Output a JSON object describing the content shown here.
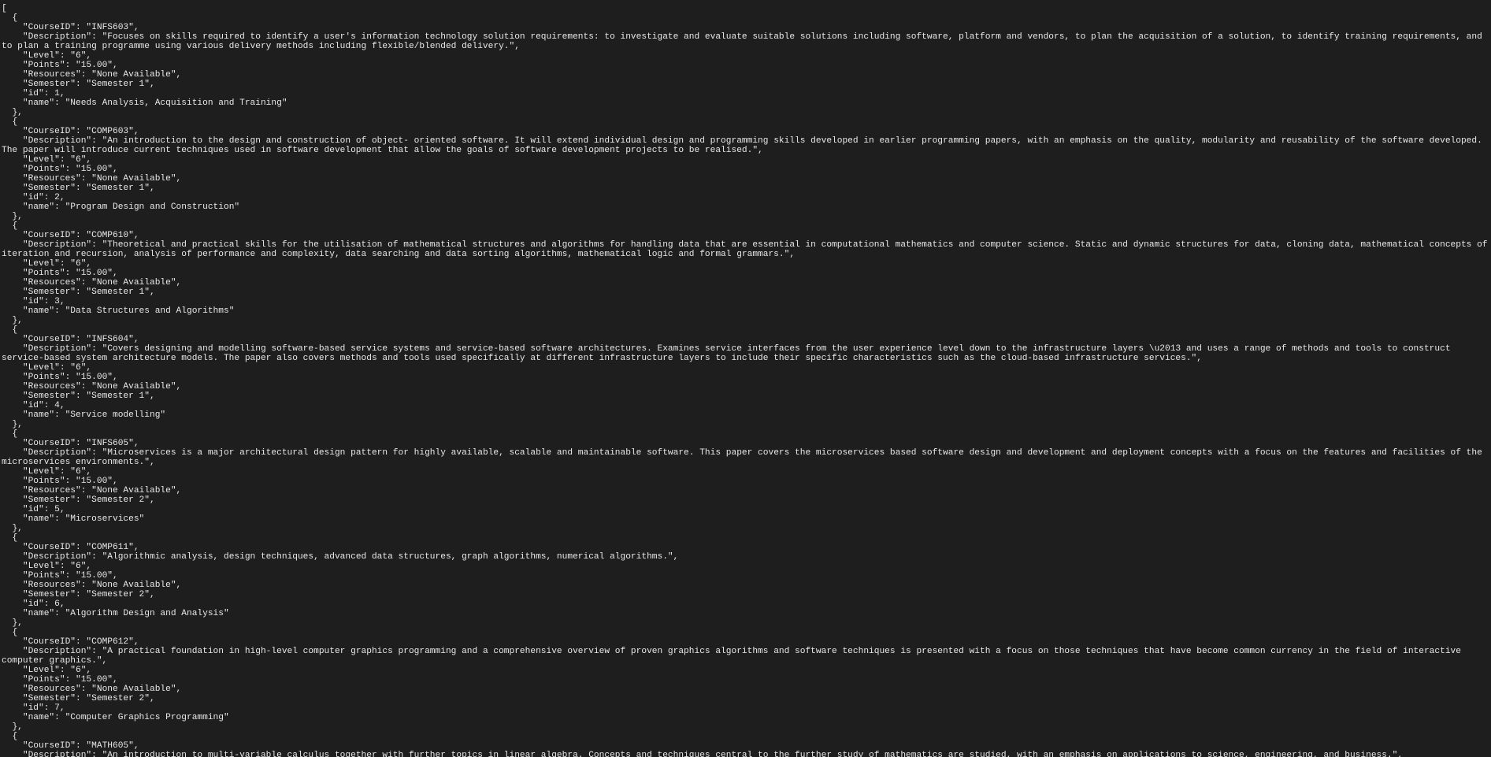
{
  "json_viewer": {
    "lines": [
      "[",
      "  {",
      "    \"CourseID\": \"INFS603\",",
      "    \"Description\": \"Focuses on skills required to identify a user's information technology solution requirements: to investigate and evaluate suitable solutions including software, platform and vendors, to plan the acquisition of a solution, to identify training requirements, and to plan a training programme using various delivery methods including flexible/blended delivery.\",",
      "    \"Level\": \"6\",",
      "    \"Points\": \"15.00\",",
      "    \"Resources\": \"None Available\",",
      "    \"Semester\": \"Semester 1\",",
      "    \"id\": 1,",
      "    \"name\": \"Needs Analysis, Acquisition and Training\"",
      "  },",
      "  {",
      "    \"CourseID\": \"COMP603\",",
      "    \"Description\": \"An introduction to the design and construction of object- oriented software. It will extend individual design and programming skills developed in earlier programming papers, with an emphasis on the quality, modularity and reusability of the software developed. The paper will introduce current techniques used in software development that allow the goals of software development projects to be realised.\",",
      "    \"Level\": \"6\",",
      "    \"Points\": \"15.00\",",
      "    \"Resources\": \"None Available\",",
      "    \"Semester\": \"Semester 1\",",
      "    \"id\": 2,",
      "    \"name\": \"Program Design and Construction\"",
      "  },",
      "  {",
      "    \"CourseID\": \"COMP610\",",
      "    \"Description\": \"Theoretical and practical skills for the utilisation of mathematical structures and algorithms for handling data that are essential in computational mathematics and computer science. Static and dynamic structures for data, cloning data, mathematical concepts of iteration and recursion, analysis of performance and complexity, data searching and data sorting algorithms, mathematical logic and formal grammars.\",",
      "    \"Level\": \"6\",",
      "    \"Points\": \"15.00\",",
      "    \"Resources\": \"None Available\",",
      "    \"Semester\": \"Semester 1\",",
      "    \"id\": 3,",
      "    \"name\": \"Data Structures and Algorithms\"",
      "  },",
      "  {",
      "    \"CourseID\": \"INFS604\",",
      "    \"Description\": \"Covers designing and modelling software-based service systems and service-based software architectures. Examines service interfaces from the user experience level down to the infrastructure layers \\u2013 and uses a range of methods and tools to construct service-based system architecture models. The paper also covers methods and tools used specifically at different infrastructure layers to include their specific characteristics such as the cloud-based infrastructure services.\",",
      "    \"Level\": \"6\",",
      "    \"Points\": \"15.00\",",
      "    \"Resources\": \"None Available\",",
      "    \"Semester\": \"Semester 1\",",
      "    \"id\": 4,",
      "    \"name\": \"Service modelling\"",
      "  },",
      "  {",
      "    \"CourseID\": \"INFS605\",",
      "    \"Description\": \"Microservices is a major architectural design pattern for highly available, scalable and maintainable software. This paper covers the microservices based software design and development and deployment concepts with a focus on the features and facilities of the microservices environments.\",",
      "    \"Level\": \"6\",",
      "    \"Points\": \"15.00\",",
      "    \"Resources\": \"None Available\",",
      "    \"Semester\": \"Semester 2\",",
      "    \"id\": 5,",
      "    \"name\": \"Microservices\"",
      "  },",
      "  {",
      "    \"CourseID\": \"COMP611\",",
      "    \"Description\": \"Algorithmic analysis, design techniques, advanced data structures, graph algorithms, numerical algorithms.\",",
      "    \"Level\": \"6\",",
      "    \"Points\": \"15.00\",",
      "    \"Resources\": \"None Available\",",
      "    \"Semester\": \"Semester 2\",",
      "    \"id\": 6,",
      "    \"name\": \"Algorithm Design and Analysis\"",
      "  },",
      "  {",
      "    \"CourseID\": \"COMP612\",",
      "    \"Description\": \"A practical foundation in high-level computer graphics programming and a comprehensive overview of proven graphics algorithms and software techniques is presented with a focus on those techniques that have become common currency in the field of interactive computer graphics.\",",
      "    \"Level\": \"6\",",
      "    \"Points\": \"15.00\",",
      "    \"Resources\": \"None Available\",",
      "    \"Semester\": \"Semester 2\",",
      "    \"id\": 7,",
      "    \"name\": \"Computer Graphics Programming\"",
      "  },",
      "  {",
      "    \"CourseID\": \"MATH605\",",
      "    \"Description\": \"An introduction to multi-variable calculus together with further topics in linear algebra. Concepts and techniques central to the further study of mathematics are studied, with an emphasis on applications to science, engineering, and business.\","
    ]
  }
}
